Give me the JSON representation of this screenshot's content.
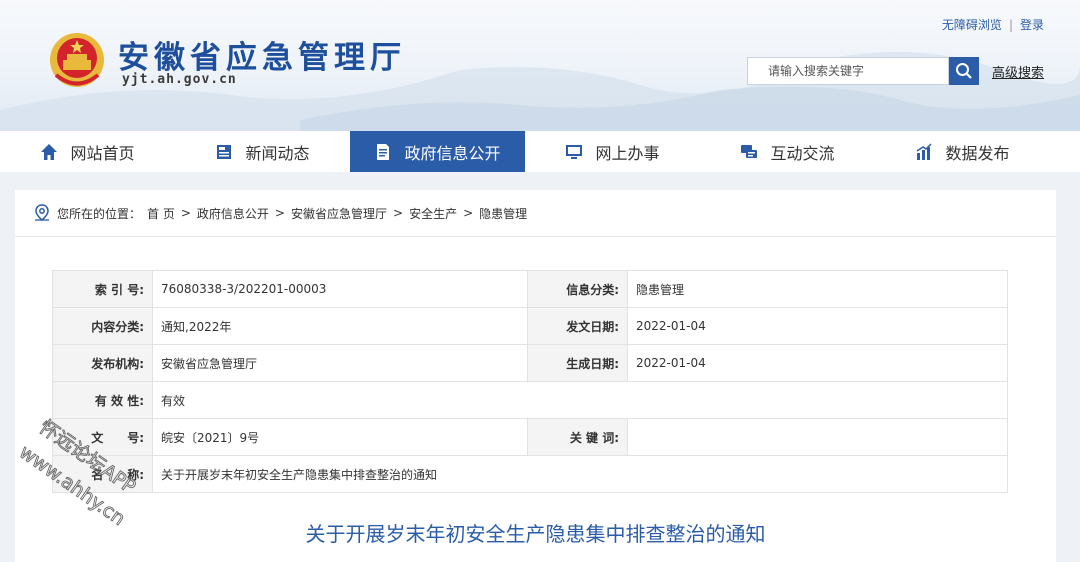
{
  "header": {
    "site_title": "安徽省应急管理厅",
    "site_domain": "yjt.ah.gov.cn",
    "links": [
      "无障碍浏览",
      "登录"
    ],
    "search": {
      "placeholder": "请输入搜索关键字",
      "advanced_label": "高级搜索"
    }
  },
  "nav": {
    "items": [
      {
        "label": "网站首页",
        "icon": "home-icon"
      },
      {
        "label": "新闻动态",
        "icon": "news-icon"
      },
      {
        "label": "政府信息公开",
        "icon": "document-icon",
        "active": true
      },
      {
        "label": "网上办事",
        "icon": "monitor-icon"
      },
      {
        "label": "互动交流",
        "icon": "chat-icon"
      },
      {
        "label": "数据发布",
        "icon": "chart-icon"
      }
    ],
    "active_color": "#2a5ca8"
  },
  "breadcrumb": {
    "prefix": "您所在的位置：",
    "items": [
      "首 页",
      "政府信息公开",
      "安徽省应急管理厅",
      "安全生产",
      "隐患管理"
    ],
    "separator": ">"
  },
  "info": {
    "rows": [
      {
        "l1": "索 引 号:",
        "v1": "76080338-3/202201-00003",
        "l2": "信息分类:",
        "v2": "隐患管理"
      },
      {
        "l1": "内容分类:",
        "v1": "通知,2022年",
        "l2": "发文日期:",
        "v2": "2022-01-04"
      },
      {
        "l1": "发布机构:",
        "v1": "安徽省应急管理厅",
        "l2": "生成日期:",
        "v2": "2022-01-04"
      },
      {
        "l1": "有 效 性:",
        "v1": "有效"
      },
      {
        "l1": "文　　号:",
        "v1": "皖安〔2021〕9号",
        "l2": "关 键 词:",
        "v2": ""
      },
      {
        "l1": "名　　称:",
        "v1": "关于开展岁末年初安全生产隐患集中排查整治的通知"
      }
    ]
  },
  "article": {
    "title": "关于开展岁末年初安全生产隐患集中排查整治的通知"
  },
  "watermark": {
    "line1": "怀远论坛APP",
    "line2": "www.ahhy.cn"
  }
}
